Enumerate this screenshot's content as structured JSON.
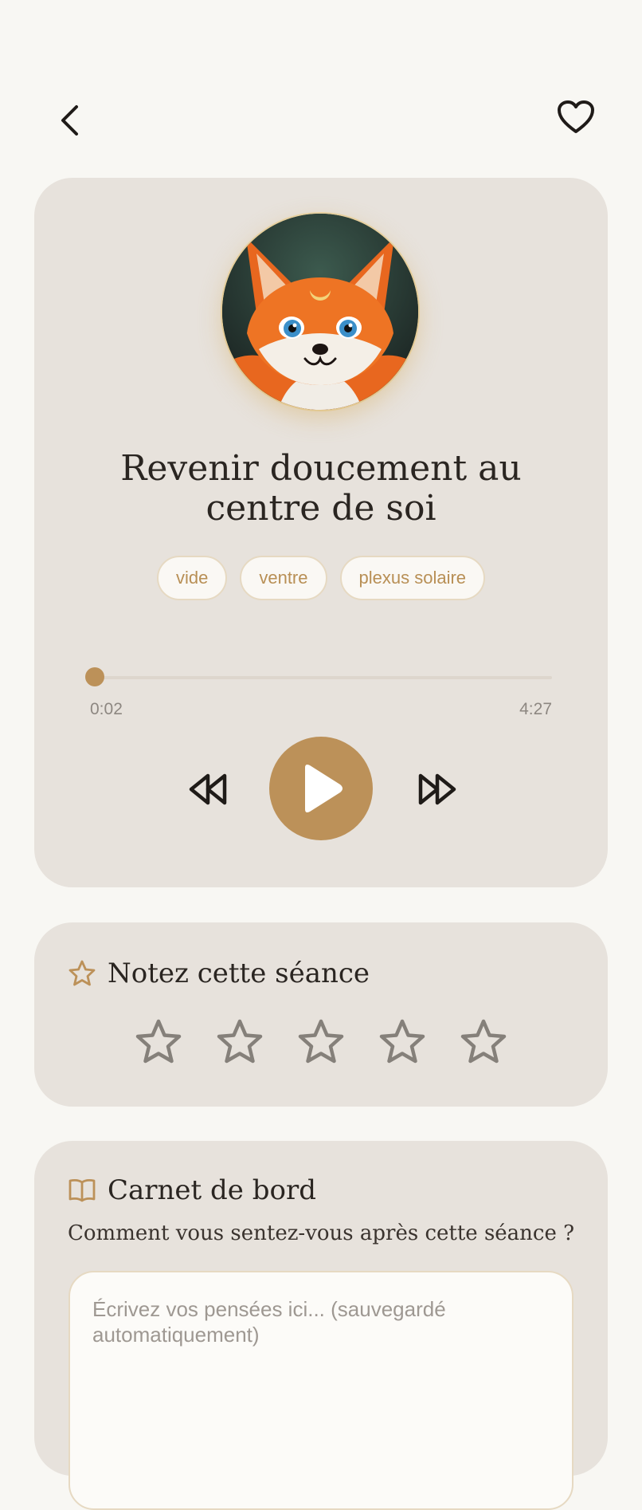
{
  "header": {
    "back_icon": "chevron-left-icon",
    "favorite_icon": "heart-icon"
  },
  "player": {
    "title": "Revenir doucement au centre de soi",
    "tags": [
      "vide",
      "ventre",
      "plexus solaire"
    ],
    "current_time": "0:02",
    "total_time": "4:27",
    "progress": 0.0,
    "rewind_icon": "rewind-icon",
    "play_icon": "play-icon",
    "forward_icon": "fast-forward-icon",
    "avatar_icon": "fox-illustration"
  },
  "rating": {
    "title": "Notez cette séance",
    "icon": "star-icon",
    "star_count": 5,
    "selected": 0
  },
  "journal": {
    "title": "Carnet de bord",
    "icon": "book-open-icon",
    "prompt": "Comment vous sentez-vous après cette séance ?",
    "placeholder": "Écrivez vos pensées ici... (sauvegardé automatiquement)",
    "value": ""
  },
  "colors": {
    "background": "#f8f7f3",
    "card": "#e7e2dc",
    "accent": "#bc9159",
    "text": "#2a2521",
    "muted": "#8d8781"
  }
}
